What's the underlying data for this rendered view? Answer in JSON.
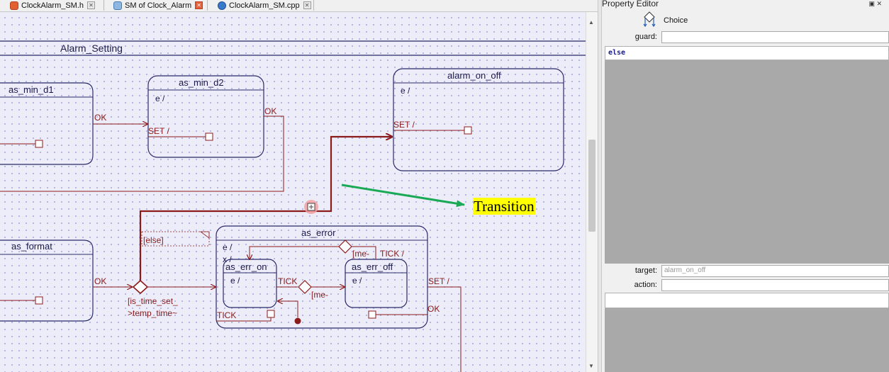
{
  "tabs": [
    {
      "label": "ClockAlarm_SM.h",
      "icon": "c-header-file-icon",
      "active": false
    },
    {
      "label": "SM of Clock_Alarm",
      "icon": "state-machine-diagram-icon",
      "active": true
    },
    {
      "label": "ClockAlarm_SM.cpp",
      "icon": "cpp-source-file-icon",
      "active": false
    }
  ],
  "diagram": {
    "superstate": "Alarm_Setting",
    "states": {
      "as_min_d1": "as_min_d1",
      "as_min_d2": "as_min_d2",
      "alarm_on_off": "alarm_on_off",
      "as_format": "as_format",
      "as_error": "as_error",
      "as_err_on": "as_err_on",
      "as_err_off": "as_err_off"
    },
    "labels": {
      "ok": "OK",
      "entry": "e /",
      "set": "SET /",
      "exit": "x /",
      "tick": "TICK",
      "tick_slash": "TICK /",
      "me1": "[me-",
      "me2": "[me-",
      "else": "[else]",
      "guard_line1": "[is_time_set_",
      "guard_line2": ">temp_time~"
    }
  },
  "annotation": {
    "text": "Transition",
    "arrow_color": "#1aaa55"
  },
  "property_editor": {
    "title": "Property Editor",
    "element_type": "Choice",
    "guard_label": "guard:",
    "guard_value": "",
    "code": "else",
    "target_label": "target:",
    "target_value": "alarm_on_off",
    "action_label": "action:",
    "action_value": ""
  },
  "colors": {
    "state_border": "#2a2a6a",
    "transition": "#8b1a1a",
    "canvas": "#ededf9"
  }
}
